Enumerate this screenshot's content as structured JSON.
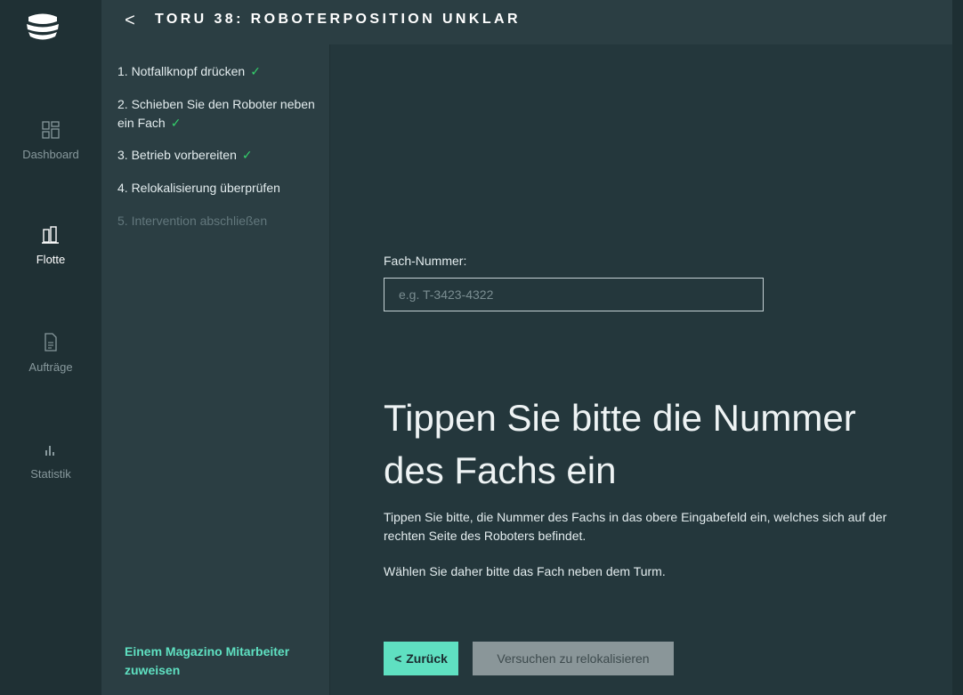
{
  "colors": {
    "accent": "#5fe0c1",
    "check": "#34d16b",
    "nav_bg": "#1f3034",
    "panel_bg": "#2b3e43",
    "main_bg": "#24373c",
    "disabled_button": "#8a9699"
  },
  "header": {
    "back_icon": "chevron-left-icon",
    "back_glyph": "<",
    "title": "TORU 38: ROBOTERPOSITION UNKLAR"
  },
  "nav": {
    "logo": "magazino-logo",
    "items": [
      {
        "label": "Dashboard",
        "icon": "dashboard-icon",
        "active": false
      },
      {
        "label": "Flotte",
        "icon": "fleet-icon",
        "active": true
      },
      {
        "label": "Aufträge",
        "icon": "document-icon",
        "active": false
      },
      {
        "label": "Statistik",
        "icon": "bar-chart-icon",
        "active": false
      }
    ]
  },
  "steps": [
    {
      "text": "1. Notfallknopf drücken",
      "done": true
    },
    {
      "text": "2. Schieben Sie den Roboter neben ein Fach",
      "done": true
    },
    {
      "text": "3. Betrieb vorbereiten",
      "done": true
    },
    {
      "text": "4. Relokalisierung überprüfen",
      "done": false
    },
    {
      "text": "5. Intervention abschließen",
      "done": false
    }
  ],
  "check_glyph": "✓",
  "assign_link": "Einem Magazino Mitarbeiter zuweisen",
  "form": {
    "label": "Fach-Nummer:",
    "value": "",
    "placeholder": "e.g. T-3423-4322"
  },
  "content": {
    "heading": "Tippen Sie bitte die Nummer des Fachs ein",
    "paragraph1": "Tippen Sie bitte, die Nummer des Fachs in das obere Eingabefeld ein, welches sich auf der rechten Seite des Roboters befindet.",
    "paragraph2": "Wählen Sie daher bitte das Fach neben dem Turm."
  },
  "buttons": {
    "back_label": "Zurück",
    "back_glyph": "<",
    "relocalize_label": "Versuchen zu relokalisieren"
  }
}
